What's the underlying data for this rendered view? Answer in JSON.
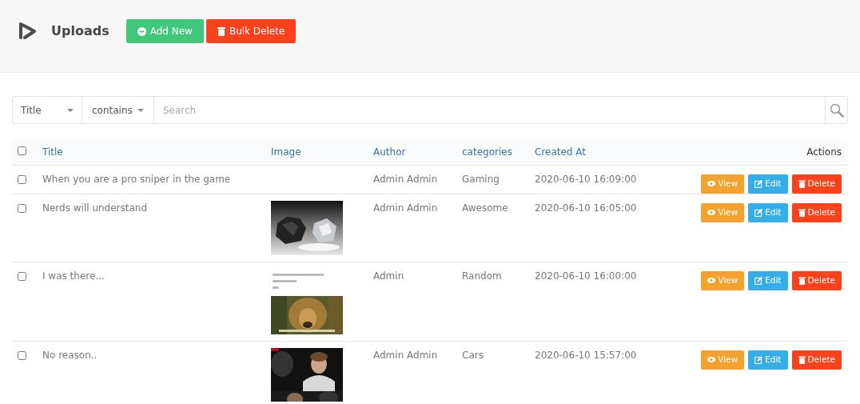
{
  "header": {
    "title": "Uploads",
    "buttons": [
      {
        "kind": "add",
        "label": "Add New"
      },
      {
        "kind": "delete",
        "label": "Bulk Delete"
      }
    ]
  },
  "filter": {
    "field": "Title",
    "operator": "contains",
    "search_placeholder": "Search"
  },
  "table": {
    "select_all": {
      "checked": false
    },
    "columns": [
      "Title",
      "Image",
      "Author",
      "categories",
      "Created At",
      "Actions"
    ],
    "rows": [
      {
        "checked": false,
        "title": "When you are a pro sniper in the game",
        "author": "Admin Admin",
        "category": "Gaming",
        "created_at": "2020-06-10 16:09:00",
        "actions": [
          "View",
          "Edit",
          "Delete"
        ]
      },
      {
        "checked": false,
        "title": "Nerds will understand",
        "image": {
          "kind": "picture"
        },
        "author": "Admin Admin",
        "category": "Awesome",
        "created_at": "2020-06-10 16:05:00",
        "actions": [
          "View",
          "Edit",
          "Delete"
        ]
      },
      {
        "checked": false,
        "title": "I was there...",
        "image": {
          "kind": "picture"
        },
        "author": "Admin",
        "category": "Random",
        "created_at": "2020-06-10 16:00:00",
        "actions": [
          "View",
          "Edit",
          "Delete"
        ]
      },
      {
        "checked": false,
        "title": "No reason..",
        "image": {
          "kind": "picture"
        },
        "author": "Admin Admin",
        "category": "Cars",
        "created_at": "2020-06-10 15:57:00",
        "actions": [
          "View",
          "Edit",
          "Delete"
        ]
      }
    ]
  }
}
